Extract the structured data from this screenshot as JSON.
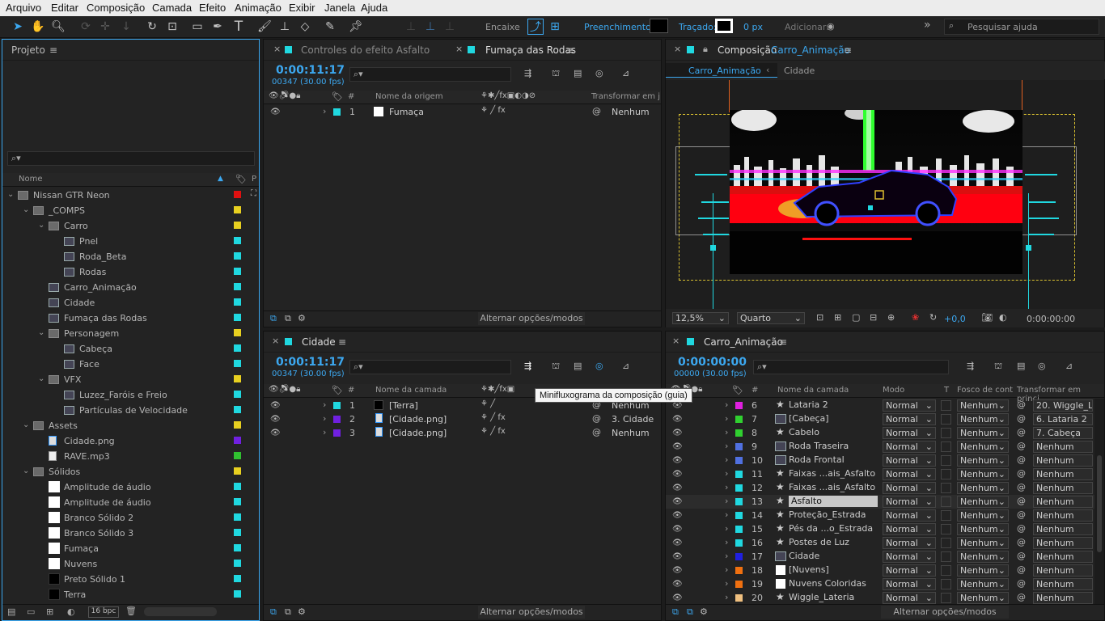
{
  "menu": [
    "Arquivo",
    "Editar",
    "Composição",
    "Camada",
    "Efeito",
    "Animação",
    "Exibir",
    "Janela",
    "Ajuda"
  ],
  "toolbar": {
    "encaixe": "Encaixe",
    "preenchimento": "Preenchimento:",
    "tracado": "Traçado:",
    "px": "0 px",
    "adicionar": "Adicionar:",
    "search_placeholder": "Pesquisar ajuda"
  },
  "project": {
    "title": "Projeto",
    "col_name": "Nome",
    "col_p": "P",
    "items": [
      {
        "label": "Nissan GTR Neon",
        "type": "folder",
        "indent": 0,
        "color": "#e01010",
        "open": true
      },
      {
        "label": "_COMPS",
        "type": "folder",
        "indent": 1,
        "color": "#e8d020",
        "open": true
      },
      {
        "label": "Carro",
        "type": "folder",
        "indent": 2,
        "color": "#e8d020",
        "open": true
      },
      {
        "label": "Pnel",
        "type": "comp",
        "indent": 3,
        "color": "#20d8e0"
      },
      {
        "label": "Roda_Beta",
        "type": "comp",
        "indent": 3,
        "color": "#20d8e0"
      },
      {
        "label": "Rodas",
        "type": "comp",
        "indent": 3,
        "color": "#20d8e0"
      },
      {
        "label": "Carro_Animação",
        "type": "comp",
        "indent": 2,
        "color": "#20d8e0"
      },
      {
        "label": "Cidade",
        "type": "comp",
        "indent": 2,
        "color": "#20d8e0"
      },
      {
        "label": "Fumaça das Rodas",
        "type": "comp",
        "indent": 2,
        "color": "#20d8e0"
      },
      {
        "label": "Personagem",
        "type": "folder",
        "indent": 2,
        "color": "#e8d020",
        "open": true
      },
      {
        "label": "Cabeça",
        "type": "comp",
        "indent": 3,
        "color": "#20d8e0"
      },
      {
        "label": "Face",
        "type": "comp",
        "indent": 3,
        "color": "#20d8e0"
      },
      {
        "label": "VFX",
        "type": "folder",
        "indent": 2,
        "color": "#e8d020",
        "open": true
      },
      {
        "label": "Luzez_Faróis e Freio",
        "type": "comp",
        "indent": 3,
        "color": "#20d8e0"
      },
      {
        "label": "Partículas de Velocidade",
        "type": "comp",
        "indent": 3,
        "color": "#20d8e0"
      },
      {
        "label": "Assets",
        "type": "folder",
        "indent": 1,
        "color": "#e8d020",
        "open": true
      },
      {
        "label": "Cidade.png",
        "type": "file",
        "indent": 2,
        "color": "#7020e0"
      },
      {
        "label": "RAVE.mp3",
        "type": "audio",
        "indent": 2,
        "color": "#30c030"
      },
      {
        "label": "Sólidos",
        "type": "folder",
        "indent": 1,
        "color": "#e8d020",
        "open": true
      },
      {
        "label": "Amplitude de áudio",
        "type": "solid",
        "indent": 2,
        "color": "#20d8e0"
      },
      {
        "label": "Amplitude de áudio",
        "type": "solid",
        "indent": 2,
        "color": "#20d8e0"
      },
      {
        "label": "Branco Sólido 2",
        "type": "solid",
        "indent": 2,
        "color": "#20d8e0"
      },
      {
        "label": "Branco Sólido 3",
        "type": "solid",
        "indent": 2,
        "color": "#20d8e0"
      },
      {
        "label": "Fumaça",
        "type": "solid",
        "indent": 2,
        "color": "#20d8e0"
      },
      {
        "label": "Nuvens",
        "type": "solid",
        "indent": 2,
        "color": "#20d8e0"
      },
      {
        "label": "Preto Sólido 1",
        "type": "blacksolid",
        "indent": 2,
        "color": "#20d8e0"
      },
      {
        "label": "Terra",
        "type": "blacksolid",
        "indent": 2,
        "color": "#20d8e0"
      }
    ],
    "bpc": "16 bpc"
  },
  "upper_tl": {
    "tab1": "Controles do efeito Asfalto",
    "tab2": "Fumaça das Rodas",
    "time": "0:00:11:17",
    "fps": "00347 (30.00 fps)",
    "col_source": "Nome da origem",
    "col_transform": "Transformar em j",
    "layers": [
      {
        "num": "1",
        "name": "Fumaça",
        "parent": "Nenhum"
      }
    ],
    "footer": "Alternar opções/modos"
  },
  "comp_view": {
    "title": "Composição",
    "comp_name": "Carro_Animação",
    "bread1": "Carro_Animação",
    "bread2": "Cidade",
    "zoom": "12,5%",
    "quality": "Quarto",
    "exposure": "+0,0",
    "timecode": "0:00:00:00"
  },
  "cidade_tl": {
    "tab": "Cidade",
    "time": "0:00:11:17",
    "fps": "00347 (30.00 fps)",
    "col_layer": "Nome da camada",
    "layers": [
      {
        "num": "1",
        "name": "[Terra]",
        "color": "#20d8e0",
        "parent": "Nenhum"
      },
      {
        "num": "2",
        "name": "[Cidade.png]",
        "color": "#7020e0",
        "parent": "3. Cidade"
      },
      {
        "num": "3",
        "name": "[Cidade.png]",
        "color": "#7020e0",
        "parent": "Nenhum"
      }
    ],
    "tooltip": "Minifluxograma da composição (guia)",
    "footer": "Alternar opções/modos"
  },
  "carro_tl": {
    "tab": "Carro_Animação",
    "time": "0:00:00:00",
    "fps": "00000 (30.00 fps)",
    "col_layer": "Nome da camada",
    "col_mode": "Modo",
    "col_t": "T",
    "col_matte": "Fosco de cont",
    "col_parent": "Transformar em princi",
    "layers": [
      {
        "num": "6",
        "name": "Lataria 2",
        "color": "#e020e0",
        "mode": "Normal",
        "matte": "Nenhum",
        "parent": "20. Wiggle_L"
      },
      {
        "num": "7",
        "name": "[Cabeça]",
        "color": "#30d030",
        "mode": "Normal",
        "matte": "Nenhum",
        "parent": "6. Lataria 2"
      },
      {
        "num": "8",
        "name": "Cabelo",
        "color": "#30d030",
        "mode": "Normal",
        "matte": "Nenhum",
        "parent": "7. Cabeça"
      },
      {
        "num": "9",
        "name": "Roda Traseira",
        "color": "#5070e0",
        "mode": "Normal",
        "matte": "Nenhum",
        "parent": "Nenhum"
      },
      {
        "num": "10",
        "name": "Roda Frontal",
        "color": "#5070e0",
        "mode": "Normal",
        "matte": "Nenhum",
        "parent": "Nenhum"
      },
      {
        "num": "11",
        "name": "Faixas ...ais_Asfalto",
        "color": "#20d8e0",
        "mode": "Normal",
        "matte": "Nenhum",
        "parent": "Nenhum"
      },
      {
        "num": "12",
        "name": "Faixas ...ais_Asfalto",
        "color": "#20d8e0",
        "mode": "Normal",
        "matte": "Nenhum",
        "parent": "Nenhum"
      },
      {
        "num": "13",
        "name": "Asfalto",
        "color": "#20d8e0",
        "mode": "Normal",
        "matte": "Nenhum",
        "parent": "Nenhum"
      },
      {
        "num": "14",
        "name": "Proteção_Estrada",
        "color": "#20d8e0",
        "mode": "Normal",
        "matte": "Nenhum",
        "parent": "Nenhum"
      },
      {
        "num": "15",
        "name": "Pés da ...o_Estrada",
        "color": "#20d8e0",
        "mode": "Normal",
        "matte": "Nenhum",
        "parent": "Nenhum"
      },
      {
        "num": "16",
        "name": "Postes de Luz",
        "color": "#20d8e0",
        "mode": "Normal",
        "matte": "Nenhum",
        "parent": "Nenhum"
      },
      {
        "num": "17",
        "name": "Cidade",
        "color": "#2020e0",
        "mode": "Normal",
        "matte": "Nenhum",
        "parent": "Nenhum"
      },
      {
        "num": "18",
        "name": "[Nuvens]",
        "color": "#f07010",
        "mode": "Normal",
        "matte": "Nenhum",
        "parent": "Nenhum"
      },
      {
        "num": "19",
        "name": "Nuvens Coloridas",
        "color": "#f07010",
        "mode": "Normal",
        "matte": "Nenhum",
        "parent": "Nenhum"
      },
      {
        "num": "20",
        "name": "Wiggle_Lateria",
        "color": "#f0c080",
        "mode": "Normal",
        "matte": "Nenhum",
        "parent": "Nenhum"
      }
    ],
    "footer": "Alternar opções/modos"
  }
}
